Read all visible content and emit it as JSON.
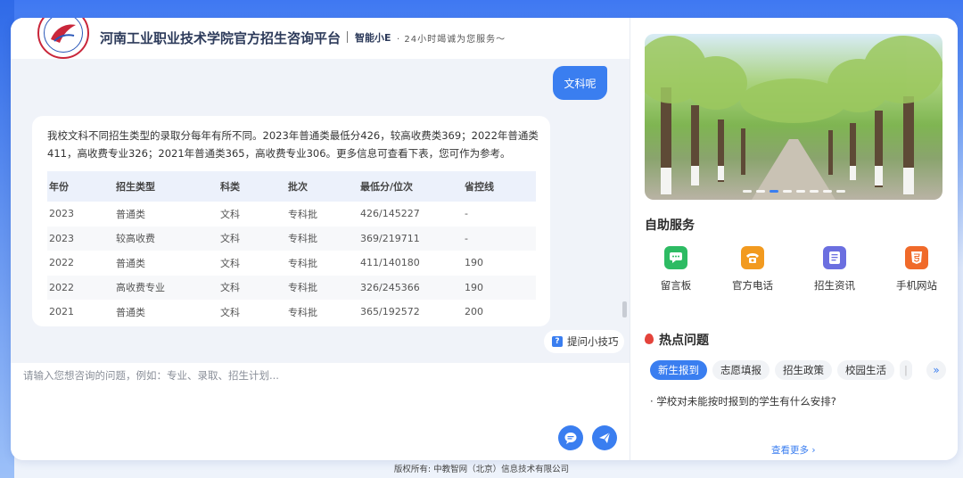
{
  "header": {
    "title": "河南工业职业技术学院官方招生咨询平台",
    "bot_name": "智能小E",
    "slogan": "· 24小时竭诚为您服务～"
  },
  "chat": {
    "user_message": "文科呢",
    "bot_message": "我校文科不同招生类型的录取分每年有所不同。2023年普通类最低分426，较高收费类369；2022年普通类411，高收费专业326；2021年普通类365，高收费专业306。更多信息可查看下表，您可作为参考。",
    "table": {
      "headers": [
        "年份",
        "招生类型",
        "科类",
        "批次",
        "最低分/位次",
        "省控线"
      ],
      "rows": [
        [
          "2023",
          "普通类",
          "文科",
          "专科批",
          "426/145227",
          "-"
        ],
        [
          "2023",
          "较高收费",
          "文科",
          "专科批",
          "369/219711",
          "-"
        ],
        [
          "2022",
          "普通类",
          "文科",
          "专科批",
          "411/140180",
          "190"
        ],
        [
          "2022",
          "高收费专业",
          "文科",
          "专科批",
          "326/245366",
          "190"
        ],
        [
          "2021",
          "普通类",
          "文科",
          "专科批",
          "365/192572",
          "200"
        ]
      ]
    },
    "tips_label": "提问小技巧"
  },
  "input": {
    "placeholder": "请输入您想咨询的问题，例如：专业、录取、招生计划..."
  },
  "right_panel": {
    "banner_dots_count": 8,
    "banner_active_dot": 3,
    "self_service_title": "自助服务",
    "services": [
      {
        "label": "留言板",
        "icon": "message-board-icon",
        "color": "#2dbb63"
      },
      {
        "label": "官方电话",
        "icon": "phone-icon",
        "color": "#f29a1f"
      },
      {
        "label": "招生资讯",
        "icon": "document-icon",
        "color": "#6b6fe0"
      },
      {
        "label": "手机网站",
        "icon": "html5-icon",
        "color": "#f06a2a"
      }
    ],
    "hot_title": "热点问题",
    "tags": [
      "新生报到",
      "志愿填报",
      "招生政策",
      "校园生活"
    ],
    "active_tag": "新生报到",
    "question": "学校对未能按时报到的学生有什么安排?",
    "see_more": "查看更多"
  },
  "footer": {
    "copyright": "版权所有: 中教智网（北京）信息技术有限公司"
  },
  "colors": {
    "accent": "#3a7ef0",
    "hot": "#e4433b"
  }
}
